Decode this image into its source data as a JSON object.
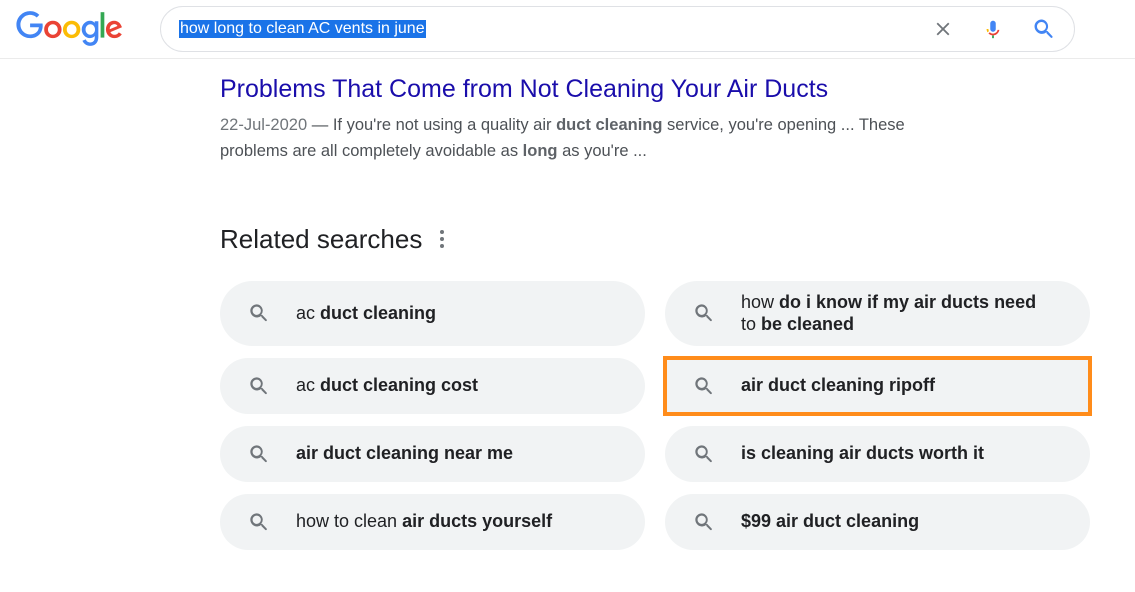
{
  "search": {
    "query": "how long to clean AC vents in june"
  },
  "result": {
    "title": "Problems That Come from Not Cleaning Your Air Ducts",
    "date": "22-Jul-2020",
    "snippet_plain_1": "If you're not using a quality air ",
    "bold1": "duct cleaning",
    "snippet_plain_2": " service, you're opening ... These problems are all completely avoidable as ",
    "bold2": "long",
    "snippet_plain_3": " as you're ..."
  },
  "related": {
    "heading": "Related searches",
    "items": [
      {
        "prefix": "ac ",
        "bold": "duct cleaning",
        "suffix": ""
      },
      {
        "prefix": "ac ",
        "bold": "duct cleaning cost",
        "suffix": ""
      },
      {
        "prefix": "",
        "bold": "air duct cleaning near me",
        "suffix": ""
      },
      {
        "prefix": "how to clean ",
        "bold": "air ducts yourself",
        "suffix": ""
      },
      {
        "prefix": "how ",
        "bold": "do i know if my air ducts need",
        "suffix": " to ",
        "bold2": "be cleaned"
      },
      {
        "prefix": "",
        "bold": "air duct cleaning ripoff",
        "suffix": "",
        "highlight": true
      },
      {
        "prefix": "",
        "bold": "is cleaning air ducts worth it",
        "suffix": ""
      },
      {
        "prefix": "",
        "bold": "$99 air duct cleaning",
        "suffix": ""
      }
    ]
  }
}
